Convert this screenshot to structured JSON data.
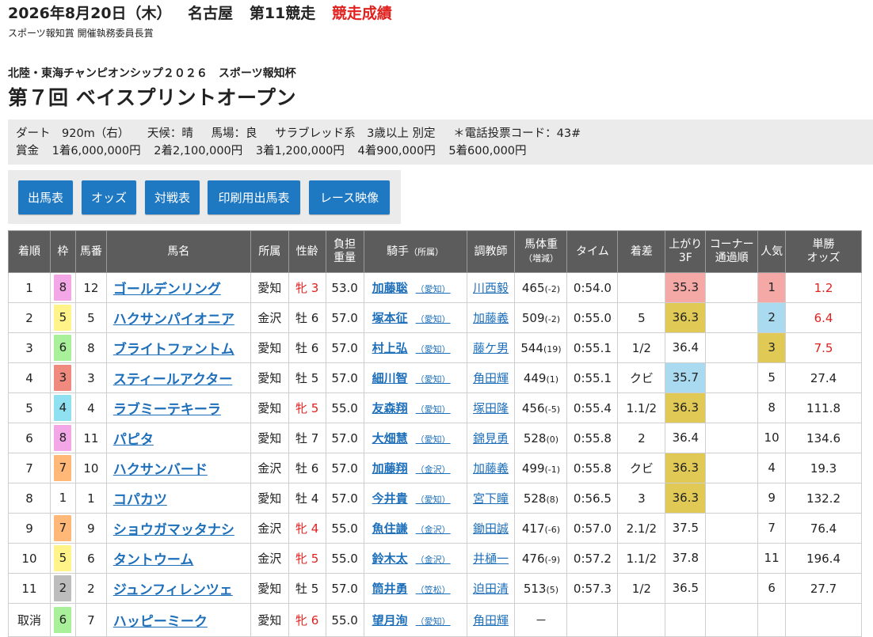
{
  "header": {
    "date": "2026年8月20日（木）",
    "venue": "名古屋",
    "race_no": "第11競走",
    "result_label": "競走成績",
    "prize_name": "スポーツ報知賞 開催執務委員長賞"
  },
  "race": {
    "series": "北陸・東海チャンピオンシップ２０２６　スポーツ報知杯",
    "title": "第７回 ベイスプリントオープン"
  },
  "info": {
    "course": "ダート　920m（右）",
    "weather": "天候：晴",
    "track": "馬場：良",
    "conditions": "サラブレッド系　3歳以上 別定",
    "phone_code": "＊電話投票コード：43#",
    "prize_label": "賞金",
    "prizes": [
      "1着6,000,000円",
      "2着2,100,000円",
      "3着1,200,000円",
      "4着900,000円",
      "5着600,000円"
    ]
  },
  "buttons": [
    "出馬表",
    "オッズ",
    "対戦表",
    "印刷用出馬表",
    "レース映像"
  ],
  "table": {
    "headers": {
      "rank": "着順",
      "waku": "枠",
      "num": "馬番",
      "horse": "馬名",
      "affil": "所属",
      "sexage": "性齢",
      "burden_1": "負担",
      "burden_2": "重量",
      "jockey_main": "騎手",
      "jockey_sub": "（所属）",
      "trainer": "調教師",
      "bw_1": "馬体重",
      "bw_2": "（増減）",
      "time": "タイム",
      "margin": "着差",
      "last3f_1": "上がり",
      "last3f_2": "3F",
      "corner_1": "コーナー",
      "corner_2": "通過順",
      "pop": "人気",
      "odds_1": "単勝",
      "odds_2": "オッズ"
    },
    "rows": [
      {
        "rank": "1",
        "waku": "8",
        "num": "12",
        "horse": "ゴールデンリング",
        "affil": "愛知",
        "sexage": "牝 3",
        "female": true,
        "weight": "53.0",
        "jockey": "加藤聡",
        "jaffil": "（愛知）",
        "trainer": "川西毅",
        "bw": "465",
        "bwc": "(-2)",
        "time": "0:54.0",
        "margin": "",
        "last3f": "35.3",
        "l3": "pink",
        "corner": "",
        "pop": "1",
        "pc": "pink",
        "odds": "1.2",
        "oddred": true
      },
      {
        "rank": "2",
        "waku": "5",
        "num": "5",
        "horse": "ハクサンパイオニア",
        "affil": "金沢",
        "sexage": "牡 6",
        "female": false,
        "weight": "57.0",
        "jockey": "塚本征",
        "jaffil": "（愛知）",
        "trainer": "加藤義",
        "bw": "509",
        "bwc": "(-2)",
        "time": "0:55.0",
        "margin": "5",
        "last3f": "36.3",
        "l3": "gold",
        "corner": "",
        "pop": "2",
        "pc": "blue",
        "odds": "6.4",
        "oddred": true
      },
      {
        "rank": "3",
        "waku": "6",
        "num": "8",
        "horse": "ブライトファントム",
        "affil": "愛知",
        "sexage": "牡 6",
        "female": false,
        "weight": "57.0",
        "jockey": "村上弘",
        "jaffil": "（愛知）",
        "trainer": "藤ケ男",
        "bw": "544",
        "bwc": "(19)",
        "time": "0:55.1",
        "margin": "1/2",
        "last3f": "36.4",
        "l3": "",
        "corner": "",
        "pop": "3",
        "pc": "gold",
        "odds": "7.5",
        "oddred": true
      },
      {
        "rank": "4",
        "waku": "3",
        "num": "3",
        "horse": "スティールアクター",
        "affil": "愛知",
        "sexage": "牡 5",
        "female": false,
        "weight": "57.0",
        "jockey": "細川智",
        "jaffil": "（愛知）",
        "trainer": "角田輝",
        "bw": "449",
        "bwc": "(1)",
        "time": "0:55.1",
        "margin": "クビ",
        "last3f": "35.7",
        "l3": "blue",
        "corner": "",
        "pop": "5",
        "pc": "",
        "odds": "27.4",
        "oddred": false
      },
      {
        "rank": "5",
        "waku": "4",
        "num": "4",
        "horse": "ラブミーテキーラ",
        "affil": "愛知",
        "sexage": "牝 5",
        "female": true,
        "weight": "55.0",
        "jockey": "友森翔",
        "jaffil": "（愛知）",
        "trainer": "塚田隆",
        "bw": "456",
        "bwc": "(-5)",
        "time": "0:55.4",
        "margin": "1.1/2",
        "last3f": "36.3",
        "l3": "gold",
        "corner": "",
        "pop": "8",
        "pc": "",
        "odds": "111.8",
        "oddred": false
      },
      {
        "rank": "6",
        "waku": "8",
        "num": "11",
        "horse": "パピタ",
        "affil": "愛知",
        "sexage": "牡 7",
        "female": false,
        "weight": "57.0",
        "jockey": "大畑慧",
        "jaffil": "（愛知）",
        "trainer": "錦見勇",
        "bw": "528",
        "bwc": "(0)",
        "time": "0:55.8",
        "margin": "2",
        "last3f": "36.4",
        "l3": "",
        "corner": "",
        "pop": "10",
        "pc": "",
        "odds": "134.6",
        "oddred": false
      },
      {
        "rank": "7",
        "waku": "7",
        "num": "10",
        "horse": "ハクサンバード",
        "affil": "金沢",
        "sexage": "牡 6",
        "female": false,
        "weight": "57.0",
        "jockey": "加藤翔",
        "jaffil": "（金沢）",
        "trainer": "加藤義",
        "bw": "499",
        "bwc": "(-1)",
        "time": "0:55.8",
        "margin": "クビ",
        "last3f": "36.3",
        "l3": "gold",
        "corner": "",
        "pop": "4",
        "pc": "",
        "odds": "19.3",
        "oddred": false
      },
      {
        "rank": "8",
        "waku": "1",
        "num": "1",
        "horse": "コパカツ",
        "affil": "愛知",
        "sexage": "牡 4",
        "female": false,
        "weight": "57.0",
        "jockey": "今井貴",
        "jaffil": "（愛知）",
        "trainer": "宮下瞳",
        "bw": "528",
        "bwc": "(8)",
        "time": "0:56.5",
        "margin": "3",
        "last3f": "36.3",
        "l3": "gold",
        "corner": "",
        "pop": "9",
        "pc": "",
        "odds": "132.2",
        "oddred": false
      },
      {
        "rank": "9",
        "waku": "7",
        "num": "9",
        "horse": "ショウガマッタナシ",
        "affil": "金沢",
        "sexage": "牝 4",
        "female": true,
        "weight": "55.0",
        "jockey": "魚住謙",
        "jaffil": "（金沢）",
        "trainer": "鋤田誠",
        "bw": "417",
        "bwc": "(-6)",
        "time": "0:57.0",
        "margin": "2.1/2",
        "last3f": "37.5",
        "l3": "",
        "corner": "",
        "pop": "7",
        "pc": "",
        "odds": "76.4",
        "oddred": false
      },
      {
        "rank": "10",
        "waku": "5",
        "num": "6",
        "horse": "タントウーム",
        "affil": "金沢",
        "sexage": "牝 5",
        "female": true,
        "weight": "55.0",
        "jockey": "鈴木太",
        "jaffil": "（金沢）",
        "trainer": "井樋一",
        "bw": "476",
        "bwc": "(-9)",
        "time": "0:57.2",
        "margin": "1.1/2",
        "last3f": "37.8",
        "l3": "",
        "corner": "",
        "pop": "11",
        "pc": "",
        "odds": "196.4",
        "oddred": false
      },
      {
        "rank": "11",
        "waku": "2",
        "num": "2",
        "horse": "ジュンフィレンツェ",
        "affil": "愛知",
        "sexage": "牡 5",
        "female": false,
        "weight": "57.0",
        "jockey": "筒井勇",
        "jaffil": "（笠松）",
        "trainer": "迫田清",
        "bw": "513",
        "bwc": "(5)",
        "time": "0:57.3",
        "margin": "1/2",
        "last3f": "36.5",
        "l3": "",
        "corner": "",
        "pop": "6",
        "pc": "",
        "odds": "27.7",
        "oddred": false
      },
      {
        "rank": "取消",
        "waku": "6",
        "num": "7",
        "horse": "ハッピーミーク",
        "affil": "愛知",
        "sexage": "牝 6",
        "female": true,
        "weight": "55.0",
        "jockey": "望月洵",
        "jaffil": "（愛知）",
        "trainer": "角田輝",
        "bw": "－",
        "bwc": "",
        "time": "",
        "margin": "",
        "last3f": "",
        "l3": "",
        "corner": "",
        "pop": "",
        "pc": "",
        "odds": "",
        "oddred": false
      }
    ]
  },
  "colors": {
    "waku": {
      "1": "#ffffff",
      "2": "#bdbdbd",
      "3": "#f08a7e",
      "4": "#8fe0f0",
      "5": "#fff38a",
      "6": "#a9f09a",
      "7": "#ffb878",
      "8": "#f3a7e6"
    },
    "highlight": {
      "pink": "#f4a9a6",
      "gold": "#e0ca55",
      "blue": "#a9daf0"
    },
    "accent_red": "#e0211e",
    "button_blue": "#1e78c2"
  }
}
